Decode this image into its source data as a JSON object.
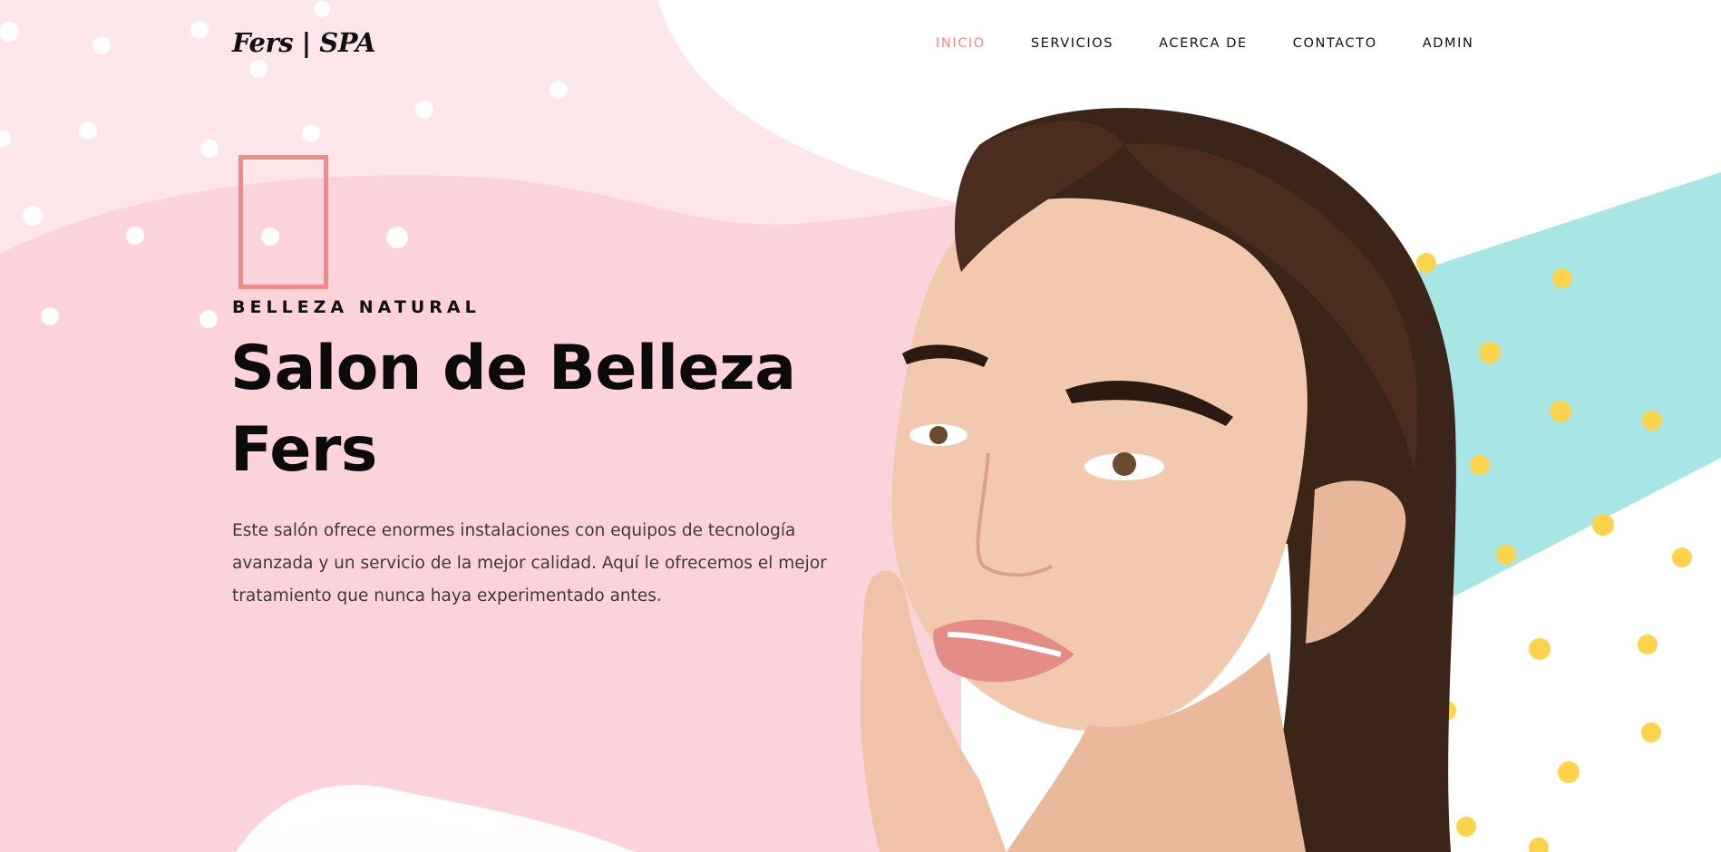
{
  "brand": {
    "logo": "Fers | SPA"
  },
  "nav": {
    "items": [
      {
        "label": "INICIO",
        "active": true
      },
      {
        "label": "SERVICIOS",
        "active": false
      },
      {
        "label": "ACERCA DE",
        "active": false
      },
      {
        "label": "CONTACTO",
        "active": false
      },
      {
        "label": "ADMIN",
        "active": false
      }
    ]
  },
  "hero": {
    "eyebrow": "BELLEZA NATURAL",
    "title_line1": "Salon de Belleza",
    "title_line2": "Fers",
    "description": "Este salón ofrece enormes instalaciones con equipos de tecnología avanzada y un servicio de la mejor calidad. Aquí le ofrecemos el mejor tratamiento que nunca haya experimentado antes."
  },
  "colors": {
    "accent": "#f08a86",
    "pink_bg": "#fcd3da",
    "pink_light": "#fde6ea",
    "teal": "#a7e6e4",
    "yellow_dots": "#fcd34d",
    "text_dark": "#111111"
  },
  "images": {
    "hero_photo": "woman-portrait-image"
  }
}
